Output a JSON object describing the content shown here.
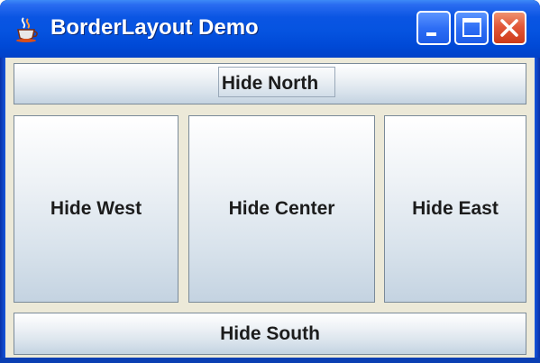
{
  "window": {
    "title": "BorderLayout Demo",
    "icon": "java-coffee-cup-icon",
    "controls": [
      "minimize-icon",
      "maximize-icon",
      "close-icon"
    ],
    "colors": {
      "titlebar": "#0553e0",
      "close_button": "#e2583a",
      "client_background": "#ece9d8",
      "button_gradient_bottom": "#c4d3e1"
    }
  },
  "buttons": {
    "north": "Hide North",
    "west": "Hide West",
    "center": "Hide Center",
    "east": "Hide East",
    "south": "Hide South"
  }
}
